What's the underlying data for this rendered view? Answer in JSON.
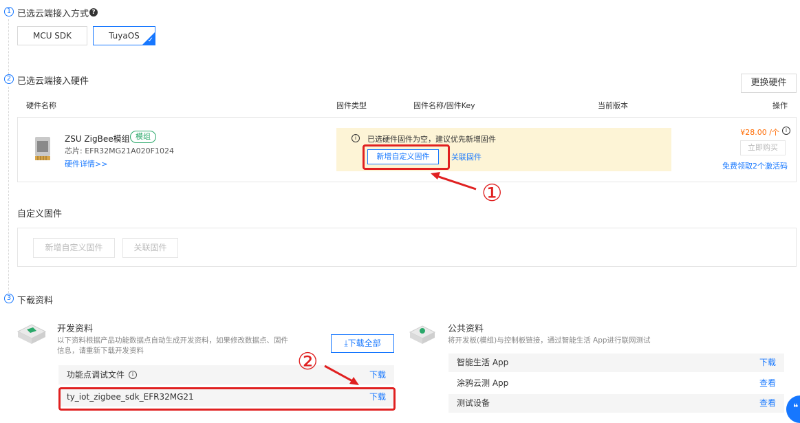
{
  "step1": {
    "num": "1",
    "title": "已选云端接入方式",
    "help": "?"
  },
  "modes": [
    {
      "label": "MCU SDK"
    },
    {
      "label": "TuyaOS"
    }
  ],
  "step2": {
    "num": "2",
    "title": "已选云端接入硬件",
    "change_btn": "更换硬件"
  },
  "table_headers": {
    "name": "硬件名称",
    "fw_type": "固件类型",
    "fw_name": "固件名称/固件Key",
    "version": "当前版本",
    "action": "操作"
  },
  "hardware": {
    "name": "ZSU ZigBee模组",
    "badge": "模组",
    "chip": "芯片: EFR32MG21A020F1024",
    "detail_link": "硬件详情>>",
    "notice": "已选硬件固件为空，建议优先新增固件",
    "add_fw_btn": "新增自定义固件",
    "link_fw": "关联固件",
    "price": "¥28.00 /个",
    "buy_btn": "立即购买",
    "free_link": "免费领取2个激活码"
  },
  "annot": {
    "one": "①",
    "two": "②"
  },
  "custom_fw": {
    "title": "自定义固件",
    "add_btn": "新增自定义固件",
    "link_btn": "关联固件"
  },
  "step3": {
    "num": "3",
    "title": "下载资料"
  },
  "dev_res": {
    "title": "开发资料",
    "desc1": "以下资料根据产品功能数据点自动生成开发资料，如果修改数据点、固件",
    "desc2": "信息，请重新下载开发资料",
    "download_all": "下载全部",
    "rows": [
      {
        "label": "功能点调试文件",
        "action": "下载"
      },
      {
        "label": "ty_iot_zigbee_sdk_EFR32MG21",
        "action": "下载"
      }
    ]
  },
  "public_res": {
    "title": "公共资料",
    "desc": "将开发板(模组)与控制板链接，通过智能生活 App进行联网测试",
    "rows": [
      {
        "label": "智能生活 App",
        "action": "下载"
      },
      {
        "label": "涂鸦云测 App",
        "action": "查看"
      },
      {
        "label": "测试设备",
        "action": "查看"
      }
    ]
  },
  "colors": {
    "primary": "#1677ff",
    "annotation": "#e02020",
    "notice_bg": "#fdf4d6",
    "price": "#ff6a00"
  }
}
